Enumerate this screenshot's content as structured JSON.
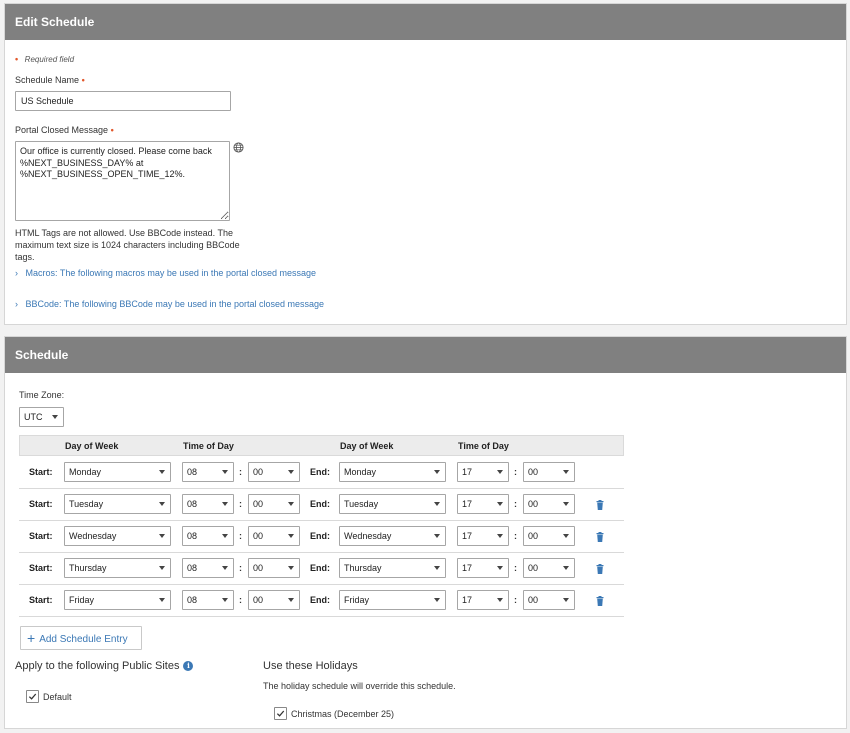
{
  "edit_schedule": {
    "title": "Edit Schedule",
    "required_note": "Required field",
    "schedule_name_label": "Schedule Name",
    "schedule_name_value": "US Schedule",
    "portal_closed_label": "Portal Closed Message",
    "portal_closed_value": "Our office is currently closed. Please come back %NEXT_BUSINESS_DAY% at %NEXT_BUSINESS_OPEN_TIME_12%.",
    "hint_line1": "HTML Tags are not allowed. Use BBCode instead. The",
    "hint_line2": "maximum text size is 1024 characters including BBCode",
    "hint_line3": "tags.",
    "macros_link": "Macros: The following macros may be used in the portal closed message",
    "bbcode_link": "BBCode: The following BBCode may be used in the portal closed message"
  },
  "schedule": {
    "title": "Schedule",
    "timezone_label": "Time Zone:",
    "timezone_value": "UTC",
    "headers": {
      "day_of_week": "Day of Week",
      "time_of_day": "Time of Day",
      "day_of_week_end": "Day of Week",
      "time_of_day_end": "Time of Day"
    },
    "start_label": "Start:",
    "end_label": "End:",
    "colon": ":",
    "rows": [
      {
        "start_day": "Monday",
        "start_hour": "08",
        "start_min": "00",
        "end_day": "Monday",
        "end_hour": "17",
        "end_min": "00"
      },
      {
        "start_day": "Tuesday",
        "start_hour": "08",
        "start_min": "00",
        "end_day": "Tuesday",
        "end_hour": "17",
        "end_min": "00"
      },
      {
        "start_day": "Wednesday",
        "start_hour": "08",
        "start_min": "00",
        "end_day": "Wednesday",
        "end_hour": "17",
        "end_min": "00"
      },
      {
        "start_day": "Thursday",
        "start_hour": "08",
        "start_min": "00",
        "end_day": "Thursday",
        "end_hour": "17",
        "end_min": "00"
      },
      {
        "start_day": "Friday",
        "start_hour": "08",
        "start_min": "00",
        "end_day": "Friday",
        "end_hour": "17",
        "end_min": "00"
      }
    ],
    "add_entry_label": "Add Schedule Entry",
    "public_sites_title": "Apply to the following Public Sites",
    "public_sites": [
      {
        "label": "Default",
        "checked": true
      }
    ],
    "holidays_title": "Use these Holidays",
    "holidays_note": "The holiday schedule will override this schedule.",
    "holidays": [
      {
        "label": "Christmas (December 25)",
        "checked": true
      }
    ]
  },
  "colors": {
    "header_bg": "#808080",
    "link": "#3b78b5",
    "required": "#e2572b"
  },
  "icons": {
    "globe": "globe-icon",
    "trash": "trash-icon",
    "info": "info-icon",
    "chevron": "chevron-right-icon",
    "plus": "plus-icon",
    "check": "checkmark-icon"
  }
}
